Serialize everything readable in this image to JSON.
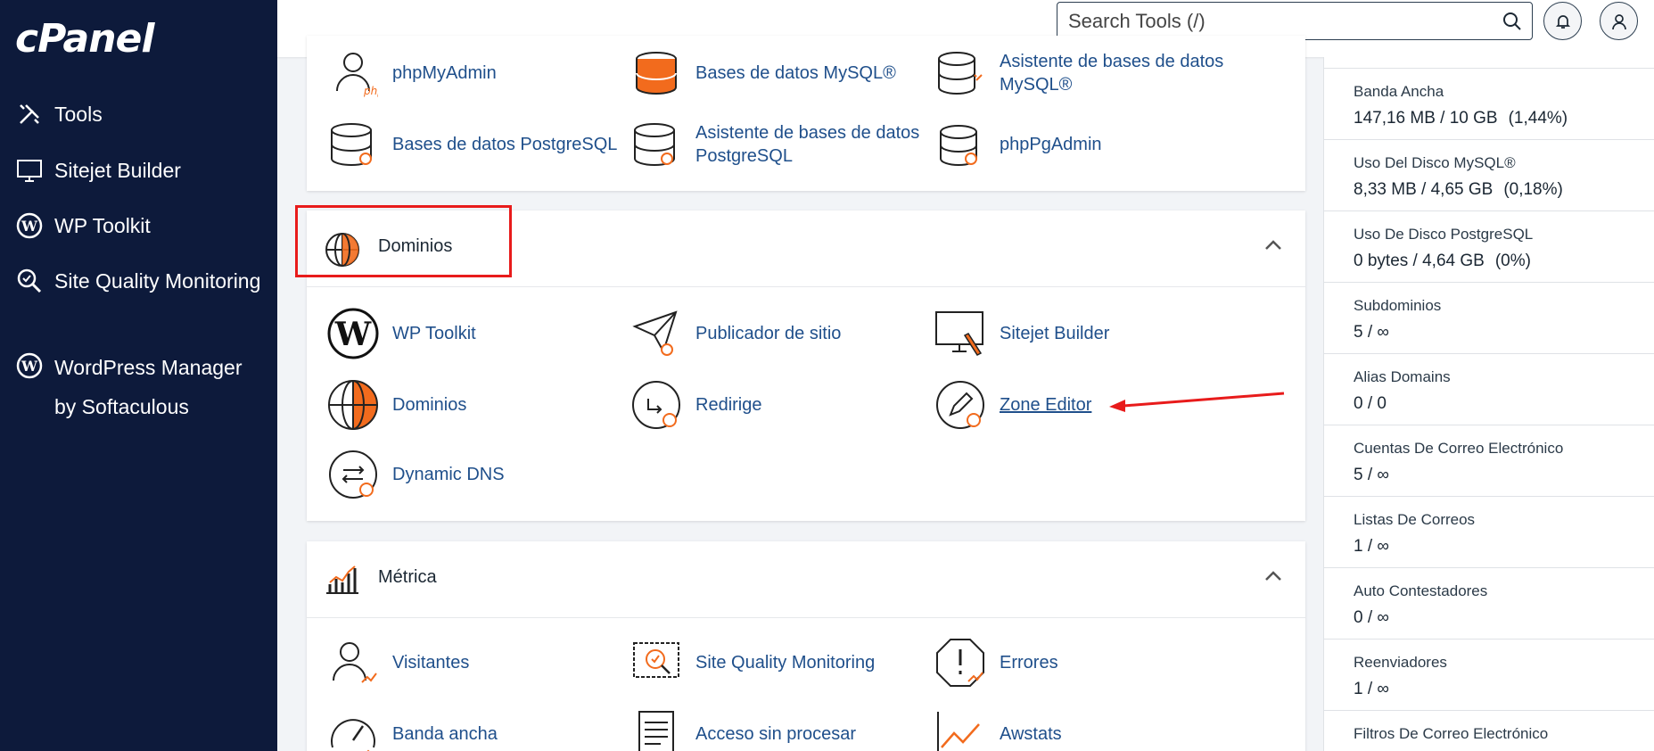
{
  "sidebar": {
    "logo": "cPanel",
    "items": [
      {
        "label": "Tools",
        "icon": "tools-icon"
      },
      {
        "label": "Sitejet Builder",
        "icon": "sitejet-icon"
      },
      {
        "label": "WP Toolkit",
        "icon": "wordpress-icon"
      },
      {
        "label": "Site Quality Monitoring",
        "icon": "site-quality-icon"
      },
      {
        "label": "WordPress Manager by Softaculous",
        "icon": "wordpress-icon"
      }
    ]
  },
  "header": {
    "search_placeholder": "Search Tools (/)"
  },
  "databases": {
    "tools": [
      {
        "label": "phpMyAdmin"
      },
      {
        "label": "Bases de datos MySQL®"
      },
      {
        "label": "Asistente de bases de datos MySQL®"
      },
      {
        "label": "Bases de datos PostgreSQL"
      },
      {
        "label": "Asistente de bases de datos PostgreSQL"
      },
      {
        "label": "phpPgAdmin"
      }
    ]
  },
  "domains": {
    "title": "Dominios",
    "tools": [
      {
        "label": "WP Toolkit"
      },
      {
        "label": "Publicador de sitio"
      },
      {
        "label": "Sitejet Builder"
      },
      {
        "label": "Dominios"
      },
      {
        "label": "Redirige"
      },
      {
        "label": "Zone Editor"
      },
      {
        "label": "Dynamic DNS"
      }
    ]
  },
  "metrics": {
    "title": "Métrica",
    "tools": [
      {
        "label": "Visitantes"
      },
      {
        "label": "Site Quality Monitoring"
      },
      {
        "label": "Errores"
      },
      {
        "label": "Banda ancha"
      },
      {
        "label": "Acceso sin procesar"
      },
      {
        "label": "Awstats"
      }
    ]
  },
  "stats": [
    {
      "label": "Banda Ancha",
      "value": "147,16 MB / 10 GB",
      "pct": "(1,44%)"
    },
    {
      "label": "Uso Del Disco MySQL®",
      "value": "8,33 MB / 4,65 GB",
      "pct": "(0,18%)"
    },
    {
      "label": "Uso De Disco PostgreSQL",
      "value": "0 bytes / 4,64 GB",
      "pct": "(0%)"
    },
    {
      "label": "Subdominios",
      "value": "5 / ∞",
      "pct": ""
    },
    {
      "label": "Alias Domains",
      "value": "0 / 0",
      "pct": ""
    },
    {
      "label": "Cuentas De Correo Electrónico",
      "value": "5 / ∞",
      "pct": ""
    },
    {
      "label": "Listas De Correos",
      "value": "1 / ∞",
      "pct": ""
    },
    {
      "label": "Auto Contestadores",
      "value": "0 / ∞",
      "pct": ""
    },
    {
      "label": "Reenviadores",
      "value": "1 / ∞",
      "pct": ""
    },
    {
      "label": "Filtros De Correo Electrónico",
      "value": "",
      "pct": ""
    }
  ],
  "colors": {
    "sidebar_bg": "#0d1a3b",
    "accent_orange": "#f26b1d",
    "link_blue": "#1f4f8b",
    "highlight_red": "#e81b1b"
  }
}
